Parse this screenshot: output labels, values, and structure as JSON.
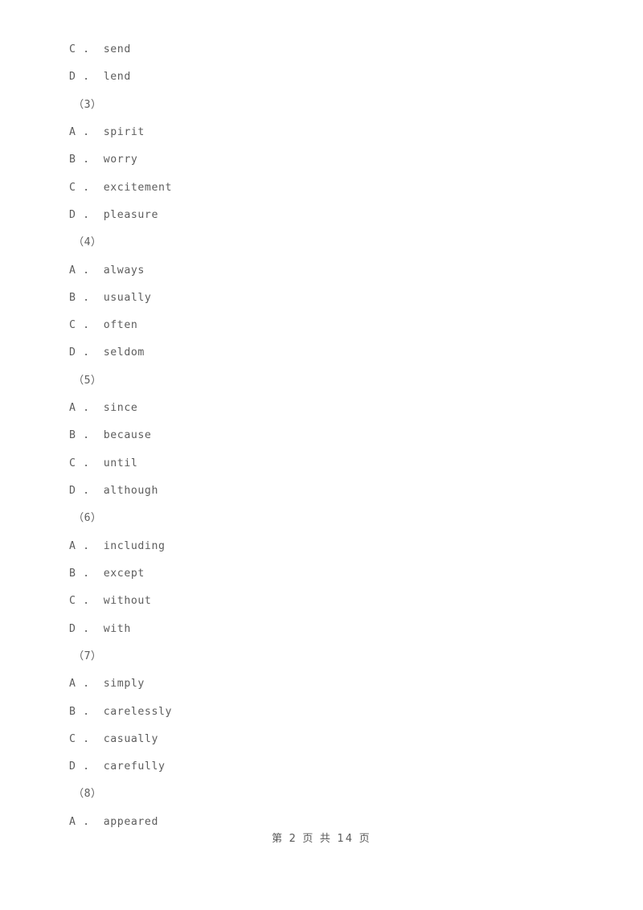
{
  "document": {
    "type": "exam-paper-page",
    "page_background": "#ffffff",
    "text_color": "#5d5d5d"
  },
  "lines": [
    {
      "kind": "option",
      "letter": "C",
      "separator": ".",
      "text": "send",
      "full": "C .  send"
    },
    {
      "kind": "option",
      "letter": "D",
      "separator": ".",
      "text": "lend",
      "full": "D .  lend"
    },
    {
      "kind": "question",
      "number": "（3）",
      "full": "（3）"
    },
    {
      "kind": "option",
      "letter": "A",
      "separator": ".",
      "text": "spirit",
      "full": "A .  spirit"
    },
    {
      "kind": "option",
      "letter": "B",
      "separator": ".",
      "text": "worry",
      "full": "B .  worry"
    },
    {
      "kind": "option",
      "letter": "C",
      "separator": ".",
      "text": "excitement",
      "full": "C .  excitement"
    },
    {
      "kind": "option",
      "letter": "D",
      "separator": ".",
      "text": "pleasure",
      "full": "D .  pleasure"
    },
    {
      "kind": "question",
      "number": "（4）",
      "full": "（4）"
    },
    {
      "kind": "option",
      "letter": "A",
      "separator": ".",
      "text": "always",
      "full": "A .  always"
    },
    {
      "kind": "option",
      "letter": "B",
      "separator": ".",
      "text": "usually",
      "full": "B .  usually"
    },
    {
      "kind": "option",
      "letter": "C",
      "separator": ".",
      "text": "often",
      "full": "C .  often"
    },
    {
      "kind": "option",
      "letter": "D",
      "separator": ".",
      "text": "seldom",
      "full": "D .  seldom"
    },
    {
      "kind": "question",
      "number": "（5）",
      "full": "（5）"
    },
    {
      "kind": "option",
      "letter": "A",
      "separator": ".",
      "text": "since",
      "full": "A .  since"
    },
    {
      "kind": "option",
      "letter": "B",
      "separator": ".",
      "text": "because",
      "full": "B .  because"
    },
    {
      "kind": "option",
      "letter": "C",
      "separator": ".",
      "text": "until",
      "full": "C .  until"
    },
    {
      "kind": "option",
      "letter": "D",
      "separator": ".",
      "text": "although",
      "full": "D .  although"
    },
    {
      "kind": "question",
      "number": "（6）",
      "full": "（6）"
    },
    {
      "kind": "option",
      "letter": "A",
      "separator": ".",
      "text": "including",
      "full": "A .  including"
    },
    {
      "kind": "option",
      "letter": "B",
      "separator": ".",
      "text": "except",
      "full": "B .  except"
    },
    {
      "kind": "option",
      "letter": "C",
      "separator": ".",
      "text": "without",
      "full": "C .  without"
    },
    {
      "kind": "option",
      "letter": "D",
      "separator": ".",
      "text": "with",
      "full": "D .  with"
    },
    {
      "kind": "question",
      "number": "（7）",
      "full": "（7）"
    },
    {
      "kind": "option",
      "letter": "A",
      "separator": ".",
      "text": "simply",
      "full": "A .  simply"
    },
    {
      "kind": "option",
      "letter": "B",
      "separator": ".",
      "text": "carelessly",
      "full": "B .  carelessly"
    },
    {
      "kind": "option",
      "letter": "C",
      "separator": ".",
      "text": "casually",
      "full": "C .  casually"
    },
    {
      "kind": "option",
      "letter": "D",
      "separator": ".",
      "text": "carefully",
      "full": "D .  carefully"
    },
    {
      "kind": "question",
      "number": "（8）",
      "full": "（8）"
    },
    {
      "kind": "option",
      "letter": "A",
      "separator": ".",
      "text": "appeared",
      "full": "A .  appeared"
    }
  ],
  "footer": {
    "text": "第 2 页 共 14 页",
    "current_page": "2",
    "total_pages": "14"
  }
}
